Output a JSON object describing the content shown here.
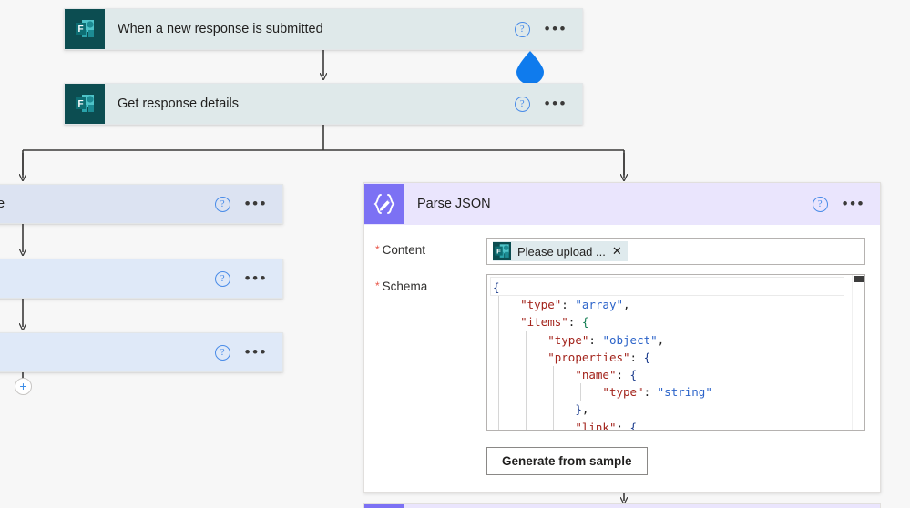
{
  "canvas": {
    "background_color": "#f7f7f7",
    "connector_color": "#3b3a39"
  },
  "trigger_card": {
    "title": "When a new response is submitted",
    "icon": "microsoft-forms-icon",
    "background_color": "#dfe9ea",
    "help_label": "?",
    "menu_label": "•••"
  },
  "action_card": {
    "title": "Get response details",
    "icon": "microsoft-forms-icon",
    "background_color": "#dfe9ea",
    "help_label": "?",
    "menu_label": "•••"
  },
  "left_branch": {
    "cards": [
      {
        "title": "e",
        "background_color": "#dce3f2",
        "help_label": "?",
        "menu_label": "•••"
      },
      {
        "title": "",
        "background_color": "#dfe9f8",
        "help_label": "?",
        "menu_label": "•••"
      },
      {
        "title": "",
        "background_color": "#dfe9f8",
        "help_label": "?",
        "menu_label": "•••"
      }
    ],
    "add_step_label": "+"
  },
  "parse_json": {
    "title": "Parse JSON",
    "icon": "parse-json-braces-icon",
    "header_color": "#eae5fd",
    "icon_color": "#7c71f4",
    "help_label": "?",
    "menu_label": "•••",
    "content_field": {
      "label": "Content",
      "required_marker": "*",
      "token": {
        "icon": "microsoft-forms-icon",
        "text": "Please upload ...",
        "remove_label": "✕"
      }
    },
    "schema_field": {
      "label": "Schema",
      "required_marker": "*",
      "code_lines": [
        [
          {
            "t": "{",
            "c": "brace"
          }
        ],
        [
          {
            "t": "    ",
            "c": "punc"
          },
          {
            "t": "\"type\"",
            "c": "key"
          },
          {
            "t": ": ",
            "c": "punc"
          },
          {
            "t": "\"array\"",
            "c": "str"
          },
          {
            "t": ",",
            "c": "punc"
          }
        ],
        [
          {
            "t": "    ",
            "c": "punc"
          },
          {
            "t": "\"items\"",
            "c": "key"
          },
          {
            "t": ": ",
            "c": "punc"
          },
          {
            "t": "{",
            "c": "brace2"
          }
        ],
        [
          {
            "t": "        ",
            "c": "punc"
          },
          {
            "t": "\"type\"",
            "c": "key"
          },
          {
            "t": ": ",
            "c": "punc"
          },
          {
            "t": "\"object\"",
            "c": "str"
          },
          {
            "t": ",",
            "c": "punc"
          }
        ],
        [
          {
            "t": "        ",
            "c": "punc"
          },
          {
            "t": "\"properties\"",
            "c": "key"
          },
          {
            "t": ": ",
            "c": "punc"
          },
          {
            "t": "{",
            "c": "brace"
          }
        ],
        [
          {
            "t": "            ",
            "c": "punc"
          },
          {
            "t": "\"name\"",
            "c": "key"
          },
          {
            "t": ": ",
            "c": "punc"
          },
          {
            "t": "{",
            "c": "brace"
          }
        ],
        [
          {
            "t": "                ",
            "c": "punc"
          },
          {
            "t": "\"type\"",
            "c": "key"
          },
          {
            "t": ": ",
            "c": "punc"
          },
          {
            "t": "\"string\"",
            "c": "str"
          }
        ],
        [
          {
            "t": "            ",
            "c": "punc"
          },
          {
            "t": "}",
            "c": "brace"
          },
          {
            "t": ",",
            "c": "punc"
          }
        ],
        [
          {
            "t": "            ",
            "c": "punc"
          },
          {
            "t": "\"link\"",
            "c": "key"
          },
          {
            "t": ": ",
            "c": "punc"
          },
          {
            "t": "{",
            "c": "brace"
          }
        ]
      ]
    },
    "generate_button_label": "Generate from sample"
  },
  "comment_marker": {
    "icon": "comment-droplet-icon",
    "color": "#0f7bed"
  }
}
